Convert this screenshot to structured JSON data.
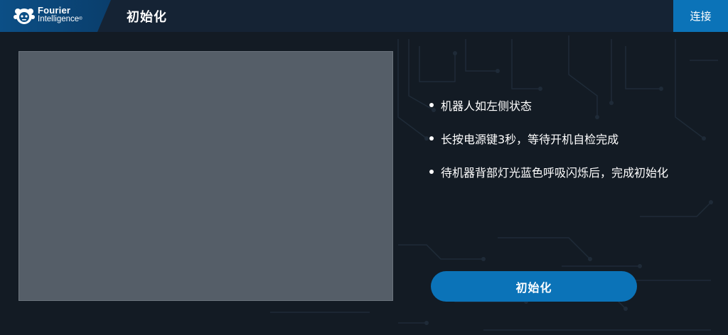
{
  "header": {
    "logo_line1": "Fourier",
    "logo_line2": "Intelligence",
    "logo_trademark": "®",
    "page_title": "初始化",
    "connect_label": "连接"
  },
  "instructions": {
    "items": [
      {
        "text": "机器人如左侧状态"
      },
      {
        "text": "长按电源键3秒，等待开机自检完成"
      },
      {
        "text": "待机器背部灯光蓝色呼吸闪烁后，完成初始化"
      }
    ]
  },
  "actions": {
    "init_label": "初始化"
  },
  "colors": {
    "accent": "#0b73b8",
    "header_bg": "#152334",
    "page_bg": "#131b24",
    "preview_bg": "#555e68"
  },
  "icons": {
    "logo": "fourier-mascot-icon",
    "bullet": "bullet-dot-icon"
  }
}
